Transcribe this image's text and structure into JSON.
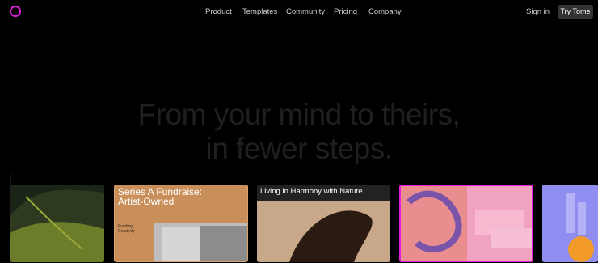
{
  "nav": {
    "links": [
      "Product",
      "Templates",
      "Community",
      "Pricing",
      "Company"
    ],
    "sign_in": "Sign in",
    "cta": "Try Tome"
  },
  "hero": {
    "line1": "From your mind to theirs,",
    "line2": "in fewer steps."
  },
  "cards": [
    {
      "title": ""
    },
    {
      "title_line1": "Series A Fundraise:",
      "title_line2": "Artist-Owned",
      "subtitle_line1": "Funding",
      "subtitle_line2": "Creativity"
    },
    {
      "title": "Living in Harmony with Nature"
    },
    {
      "title": ""
    },
    {
      "title": ""
    }
  ]
}
